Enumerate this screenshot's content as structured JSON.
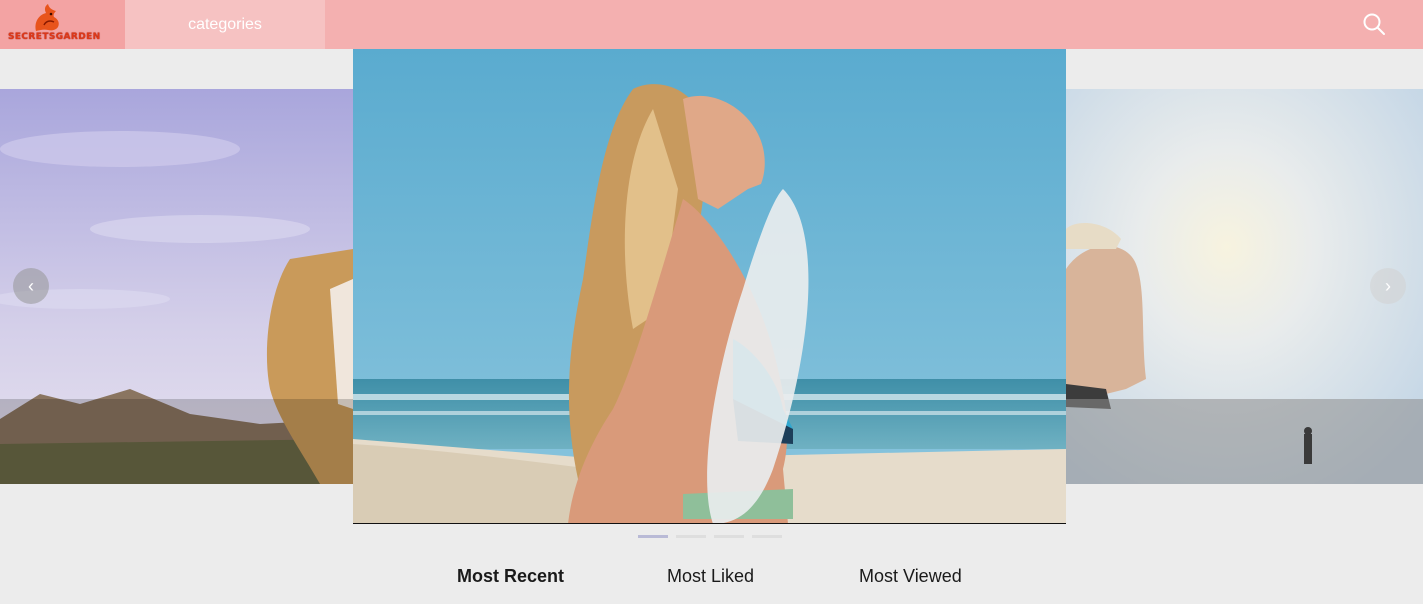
{
  "brand": {
    "name": "SECRETSGARDEN"
  },
  "header": {
    "nav": {
      "categories_label": "categories"
    },
    "search_icon": "search-icon"
  },
  "carousel": {
    "prev_icon": "chevron-left-icon",
    "next_icon": "chevron-right-icon",
    "prev_glyph": "‹",
    "next_glyph": "›",
    "slide_count": 4,
    "active_index": 0
  },
  "tabs": [
    {
      "label": "Most Recent",
      "active": true
    },
    {
      "label": "Most Liked",
      "active": false
    },
    {
      "label": "Most Viewed",
      "active": false
    }
  ],
  "colors": {
    "header_bg": "#f4b0b0",
    "logo_bg": "#f3a3a3",
    "nav_active_bg": "#f6c2c2",
    "page_bg": "#ececec",
    "brand_red": "#e03818",
    "active_dot": "#b9bad6"
  }
}
